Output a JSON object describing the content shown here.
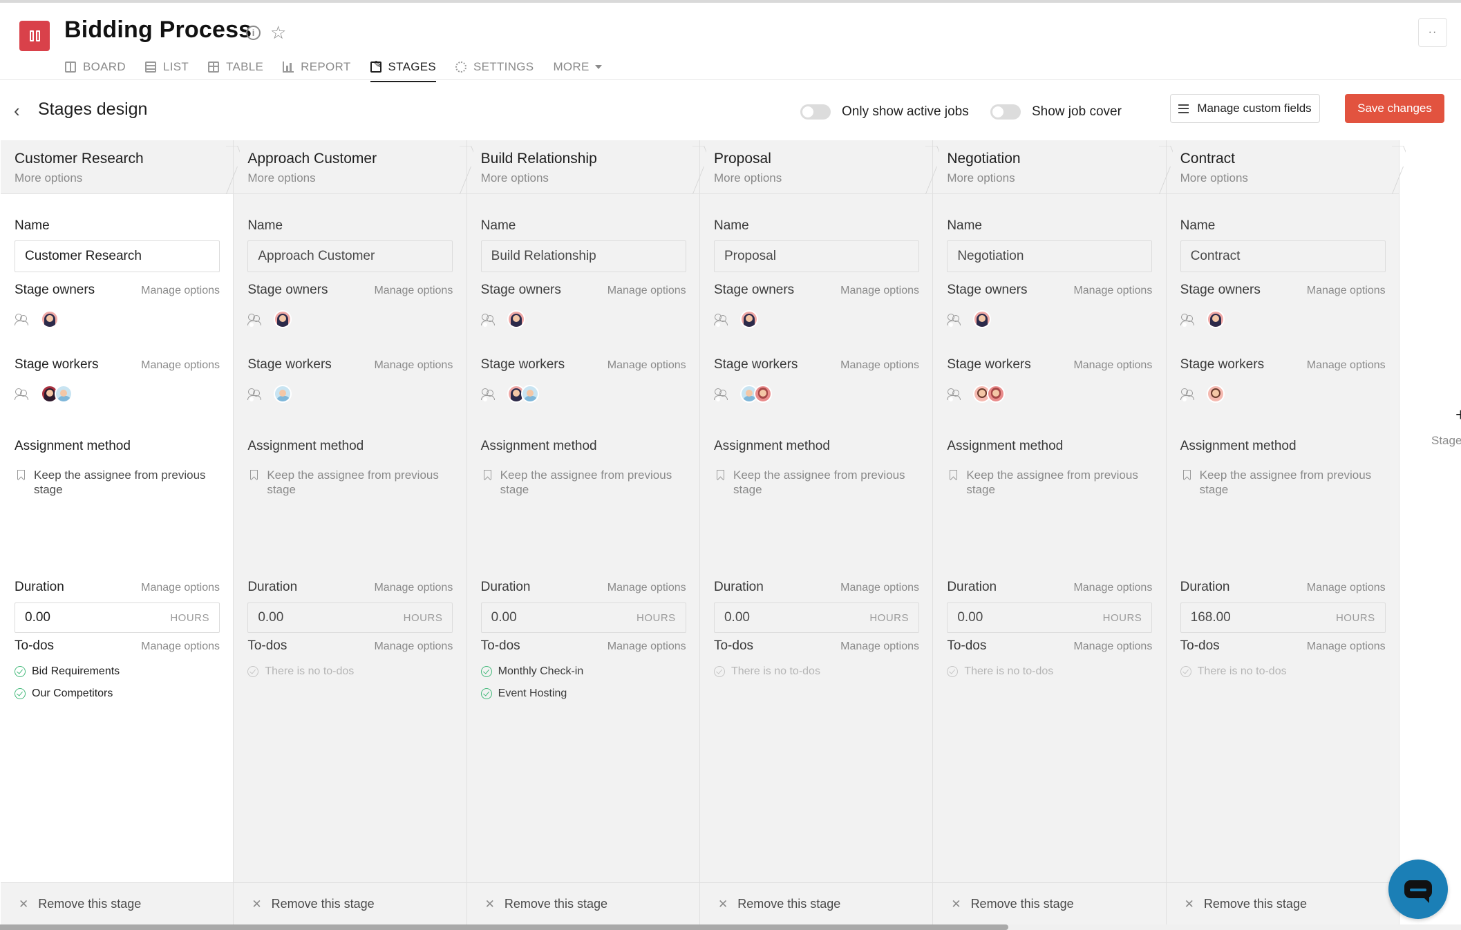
{
  "app": {
    "title": "Bidding Process",
    "nav": [
      {
        "label": "BOARD",
        "icon": "board-icon",
        "active": false
      },
      {
        "label": "LIST",
        "icon": "list-icon",
        "active": false
      },
      {
        "label": "TABLE",
        "icon": "table-icon",
        "active": false
      },
      {
        "label": "REPORT",
        "icon": "report-icon",
        "active": false
      },
      {
        "label": "STAGES",
        "icon": "stages-icon",
        "active": true
      },
      {
        "label": "SETTINGS",
        "icon": "settings-icon",
        "active": false
      },
      {
        "label": "MORE",
        "icon": "caret-down-icon",
        "active": false
      }
    ],
    "more_button": "··"
  },
  "subheader": {
    "title": "Stages design",
    "toggle_active_jobs": {
      "label": "Only show active jobs",
      "on": false
    },
    "toggle_job_cover": {
      "label": "Show job cover",
      "on": false
    },
    "manage_fields_label": "Manage custom fields",
    "save_label": "Save changes"
  },
  "labels": {
    "more_options": "More options",
    "name": "Name",
    "stage_owners": "Stage owners",
    "stage_workers": "Stage workers",
    "manage_options": "Manage options",
    "assignment_method": "Assignment method",
    "duration": "Duration",
    "todos": "To-dos",
    "unit": "HOURS",
    "remove": "Remove this stage",
    "no_todos": "There is no to-dos"
  },
  "stages": [
    {
      "name": "Customer Research",
      "owners": [
        "avatar-a"
      ],
      "workers": [
        "avatar-d",
        "avatar-b"
      ],
      "assignment": "Keep the assignee from previous stage",
      "duration": "0.00",
      "todos": [
        "Bid Requirements",
        "Our Competitors"
      ]
    },
    {
      "name": "Approach Customer",
      "owners": [
        "avatar-a"
      ],
      "workers": [
        "avatar-b"
      ],
      "assignment": "Keep the assignee from previous stage",
      "duration": "0.00",
      "todos": []
    },
    {
      "name": "Build Relationship",
      "owners": [
        "avatar-a"
      ],
      "workers": [
        "avatar-a",
        "avatar-b"
      ],
      "assignment": "Keep the assignee from previous stage",
      "duration": "0.00",
      "todos": [
        "Monthly Check-in",
        "Event Hosting"
      ]
    },
    {
      "name": "Proposal",
      "owners": [
        "avatar-a"
      ],
      "workers": [
        "avatar-b",
        "avatar-c"
      ],
      "assignment": "Keep the assignee from previous stage",
      "duration": "0.00",
      "todos": []
    },
    {
      "name": "Negotiation",
      "owners": [
        "avatar-a"
      ],
      "workers": [
        "avatar-e",
        "avatar-c"
      ],
      "assignment": "Keep the assignee from previous stage",
      "duration": "0.00",
      "todos": []
    },
    {
      "name": "Contract",
      "owners": [
        "avatar-a"
      ],
      "workers": [
        "avatar-e"
      ],
      "assignment": "Keep the assignee from previous stage",
      "duration": "168.00",
      "todos": []
    }
  ],
  "add_stage": {
    "plus": "+",
    "text": "Stage kn"
  },
  "colors": {
    "accent": "#e2533f",
    "logo": "#d9414a",
    "chat": "#1b7fb6",
    "check": "#43b97a"
  },
  "horizontal_scroll_fraction": 0.69
}
